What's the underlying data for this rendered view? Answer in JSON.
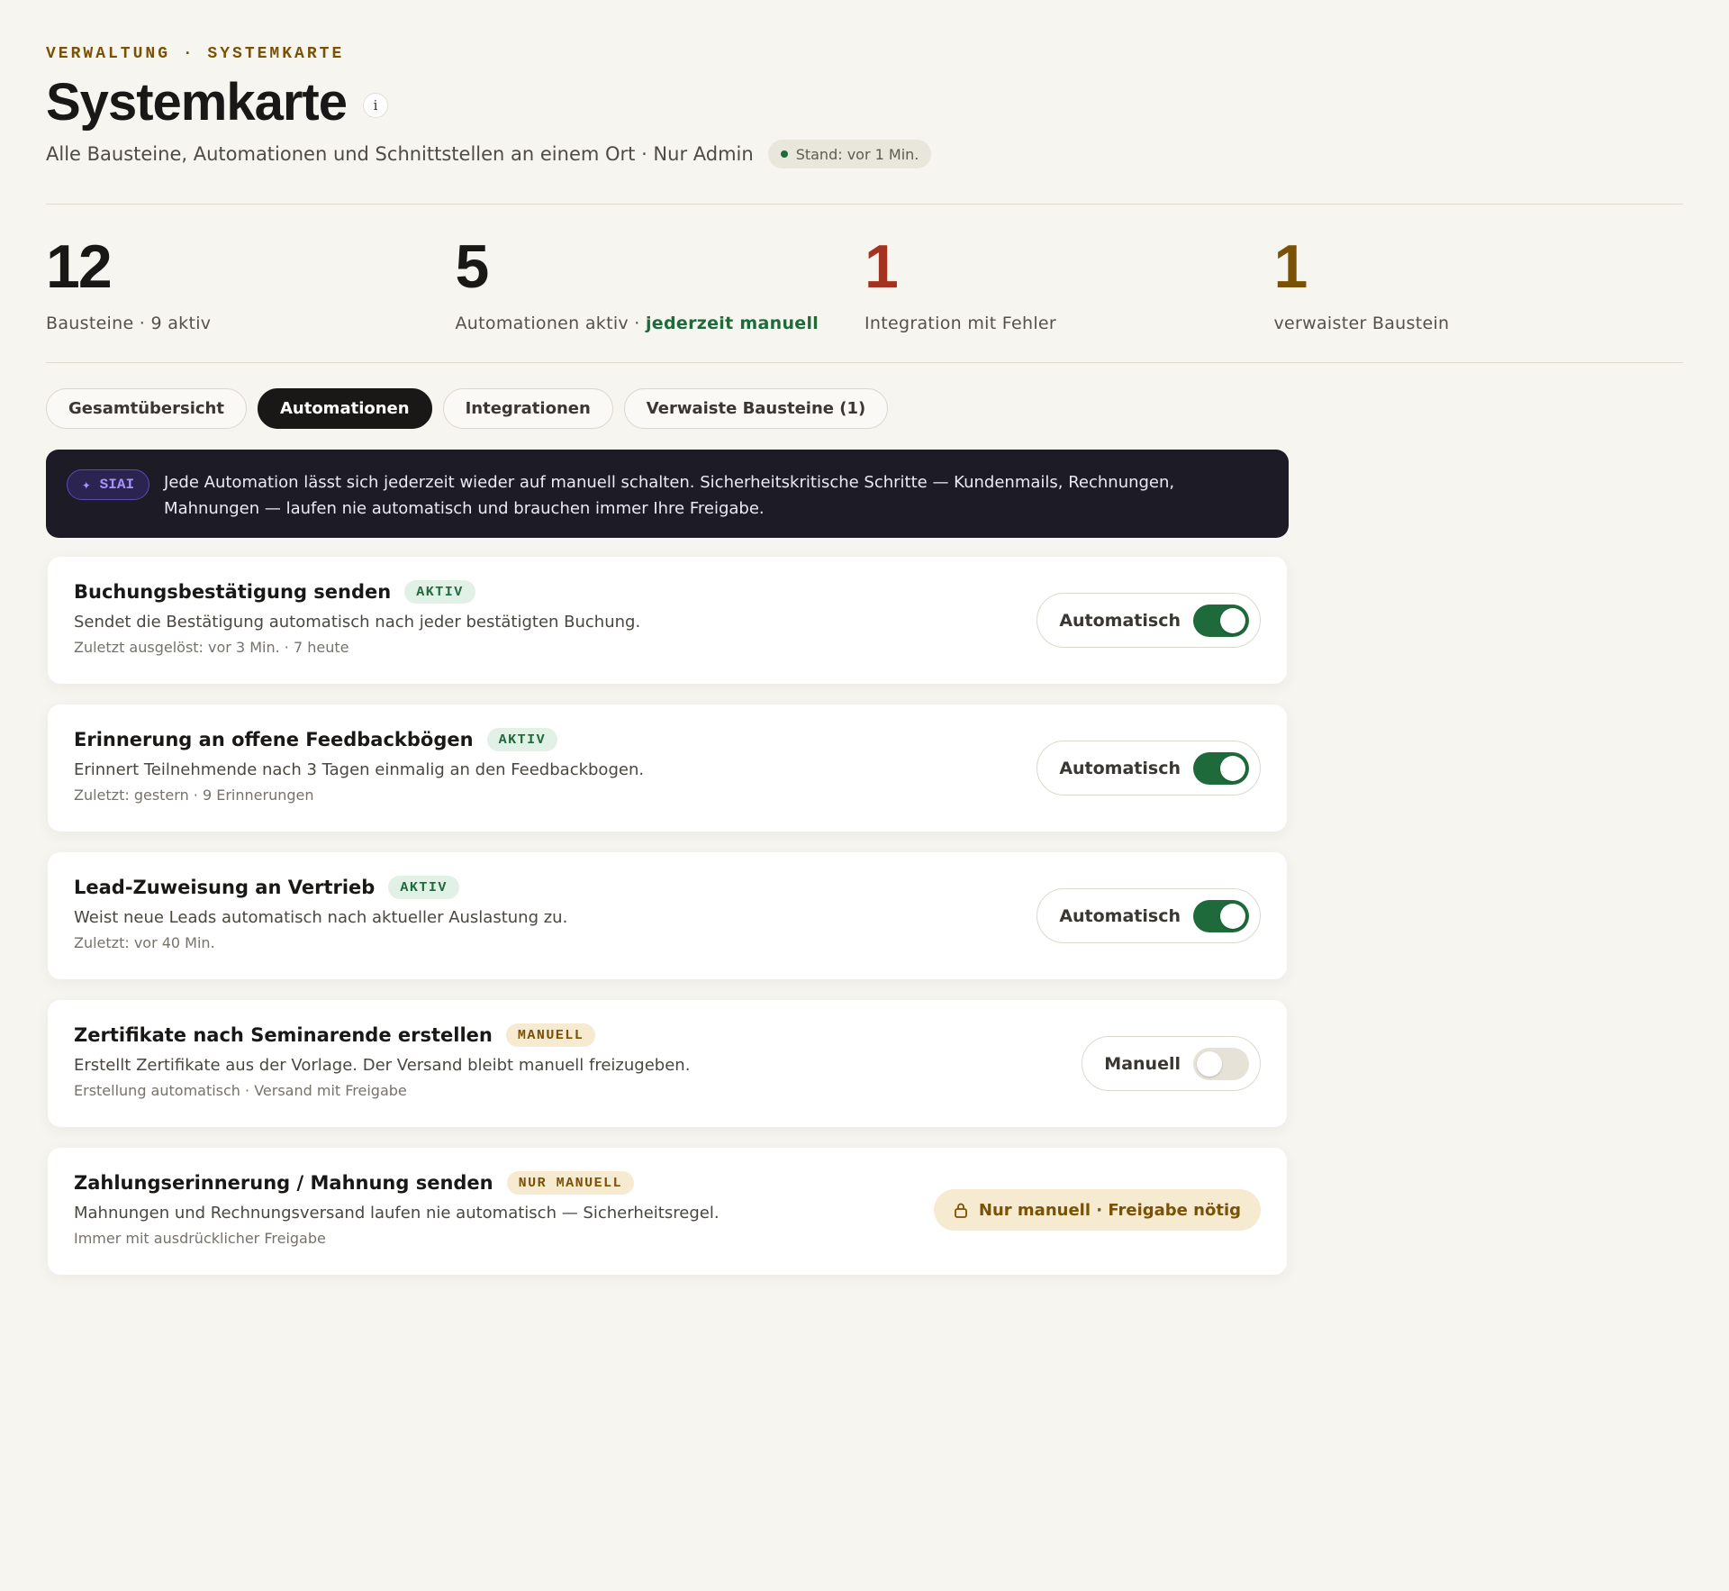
{
  "header": {
    "breadcrumb": "VERWALTUNG · SYSTEMKARTE",
    "title": "Systemkarte",
    "info_icon": "i",
    "subtitle": "Alle Bausteine, Automationen und Schnittstellen an einem Ort · Nur Admin",
    "status": "Stand: vor 1 Min."
  },
  "stats": [
    {
      "value": "12",
      "label": "Bausteine · 9 aktiv",
      "color": "#1a1816"
    },
    {
      "value": "5",
      "label": "Automationen aktiv ·",
      "accent": "jederzeit manuell",
      "color": "#1a1816"
    },
    {
      "value": "1",
      "label": "Integration mit Fehler",
      "color": "#a3321f"
    },
    {
      "value": "1",
      "label": "verwaister Baustein",
      "color": "#7a5206"
    }
  ],
  "tabs": [
    {
      "label": "Gesamtübersicht",
      "active": false
    },
    {
      "label": "Automationen",
      "active": true
    },
    {
      "label": "Integrationen",
      "active": false
    },
    {
      "label": "Verwaiste Bausteine (1)",
      "active": false
    }
  ],
  "banner": {
    "badge_icon": "✦",
    "badge": "SIAI",
    "text": "Jede Automation lässt sich jederzeit wieder auf manuell schalten. Sicherheitskritische Schritte — Kundenmails, Rechnungen, Mahnungen — laufen nie automatisch und brauchen immer Ihre Freigabe."
  },
  "automations": [
    {
      "title": "Buchungsbestätigung senden",
      "badge": "AKTIV",
      "desc": "Sendet die Bestätigung automatisch nach jeder bestätigten Buchung.",
      "meta": "Zuletzt ausgelöst: vor 3 Min. · 7 heute",
      "control_label": "Automatisch",
      "enabled": true
    },
    {
      "title": "Erinnerung an offene Feedbackbögen",
      "badge": "AKTIV",
      "desc": "Erinnert Teilnehmende nach 3 Tagen einmalig an den Feedbackbogen.",
      "meta": "Zuletzt: gestern · 9 Erinnerungen",
      "control_label": "Automatisch",
      "enabled": true
    },
    {
      "title": "Lead-Zuweisung an Vertrieb",
      "badge": "AKTIV",
      "desc": "Weist neue Leads automatisch nach aktueller Auslastung zu.",
      "meta": "Zuletzt: vor 40 Min.",
      "control_label": "Automatisch",
      "enabled": true
    },
    {
      "title": "Zertifikate nach Seminarende erstellen",
      "badge": "MANUELL",
      "desc": "Erstellt Zertifikate aus der Vorlage. Der Versand bleibt manuell freizugeben.",
      "meta": "Erstellung automatisch · Versand mit Freigabe",
      "control_label": "Manuell",
      "enabled": false
    },
    {
      "title": "Zahlungserinnerung / Mahnung senden",
      "badge": "NUR MANUELL",
      "desc": "Mahnungen und Rechnungsversand laufen nie automatisch — Sicherheitsregel.",
      "meta": "Immer mit ausdrücklicher Freigabe",
      "lock_label": "Nur manuell · Freigabe nötig"
    }
  ],
  "colors": {
    "green": "#1e6a3b",
    "red": "#a3321f",
    "amber": "#7a5206",
    "dark": "#1c1b26"
  }
}
